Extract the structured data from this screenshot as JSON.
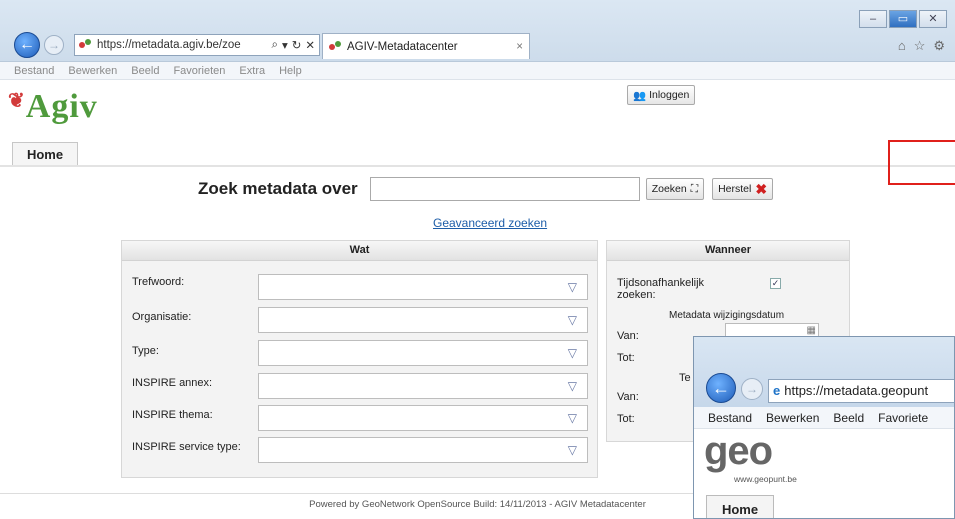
{
  "browser": {
    "url": "https://metadata.agiv.be/zoe",
    "tab_title": "AGIV-Metadatacenter",
    "menu": [
      "Bestand",
      "Bewerken",
      "Beeld",
      "Favorieten",
      "Extra",
      "Help"
    ]
  },
  "site": {
    "logo_text": "Agiv",
    "login_label": "Inloggen",
    "home_tab": "Home"
  },
  "search": {
    "label": "Zoek metadata over",
    "search_button": "Zoeken",
    "reset_button": "Herstel",
    "advanced_link": "Geavanceerd zoeken"
  },
  "wat_panel": {
    "title": "Wat",
    "fields": [
      {
        "label": "Trefwoord:"
      },
      {
        "label": "Organisatie:"
      },
      {
        "label": "Type:"
      },
      {
        "label": "INSPIRE annex:"
      },
      {
        "label": "INSPIRE thema:"
      },
      {
        "label": "INSPIRE service type:"
      }
    ]
  },
  "wanneer_panel": {
    "title": "Wanneer",
    "timeless_label": "Tijdsonafhankelijk zoeken:",
    "timeless_checked": true,
    "metadata_date_label": "Metadata wijzigingsdatum",
    "van": "Van:",
    "tot": "Tot:",
    "te": "Te",
    "van2": "Van:",
    "tot2": "Tot:"
  },
  "footer": {
    "text": "Powered by GeoNetwork OpenSource  Build: 14/11/2013 - AGIV Metadatacenter"
  },
  "overlay": {
    "url": "https://metadata.geopunt",
    "menu": [
      "Bestand",
      "Bewerken",
      "Beeld",
      "Favoriete"
    ],
    "logo": "geo",
    "subtext": "www.geopunt.be",
    "home_tab": "Home"
  }
}
